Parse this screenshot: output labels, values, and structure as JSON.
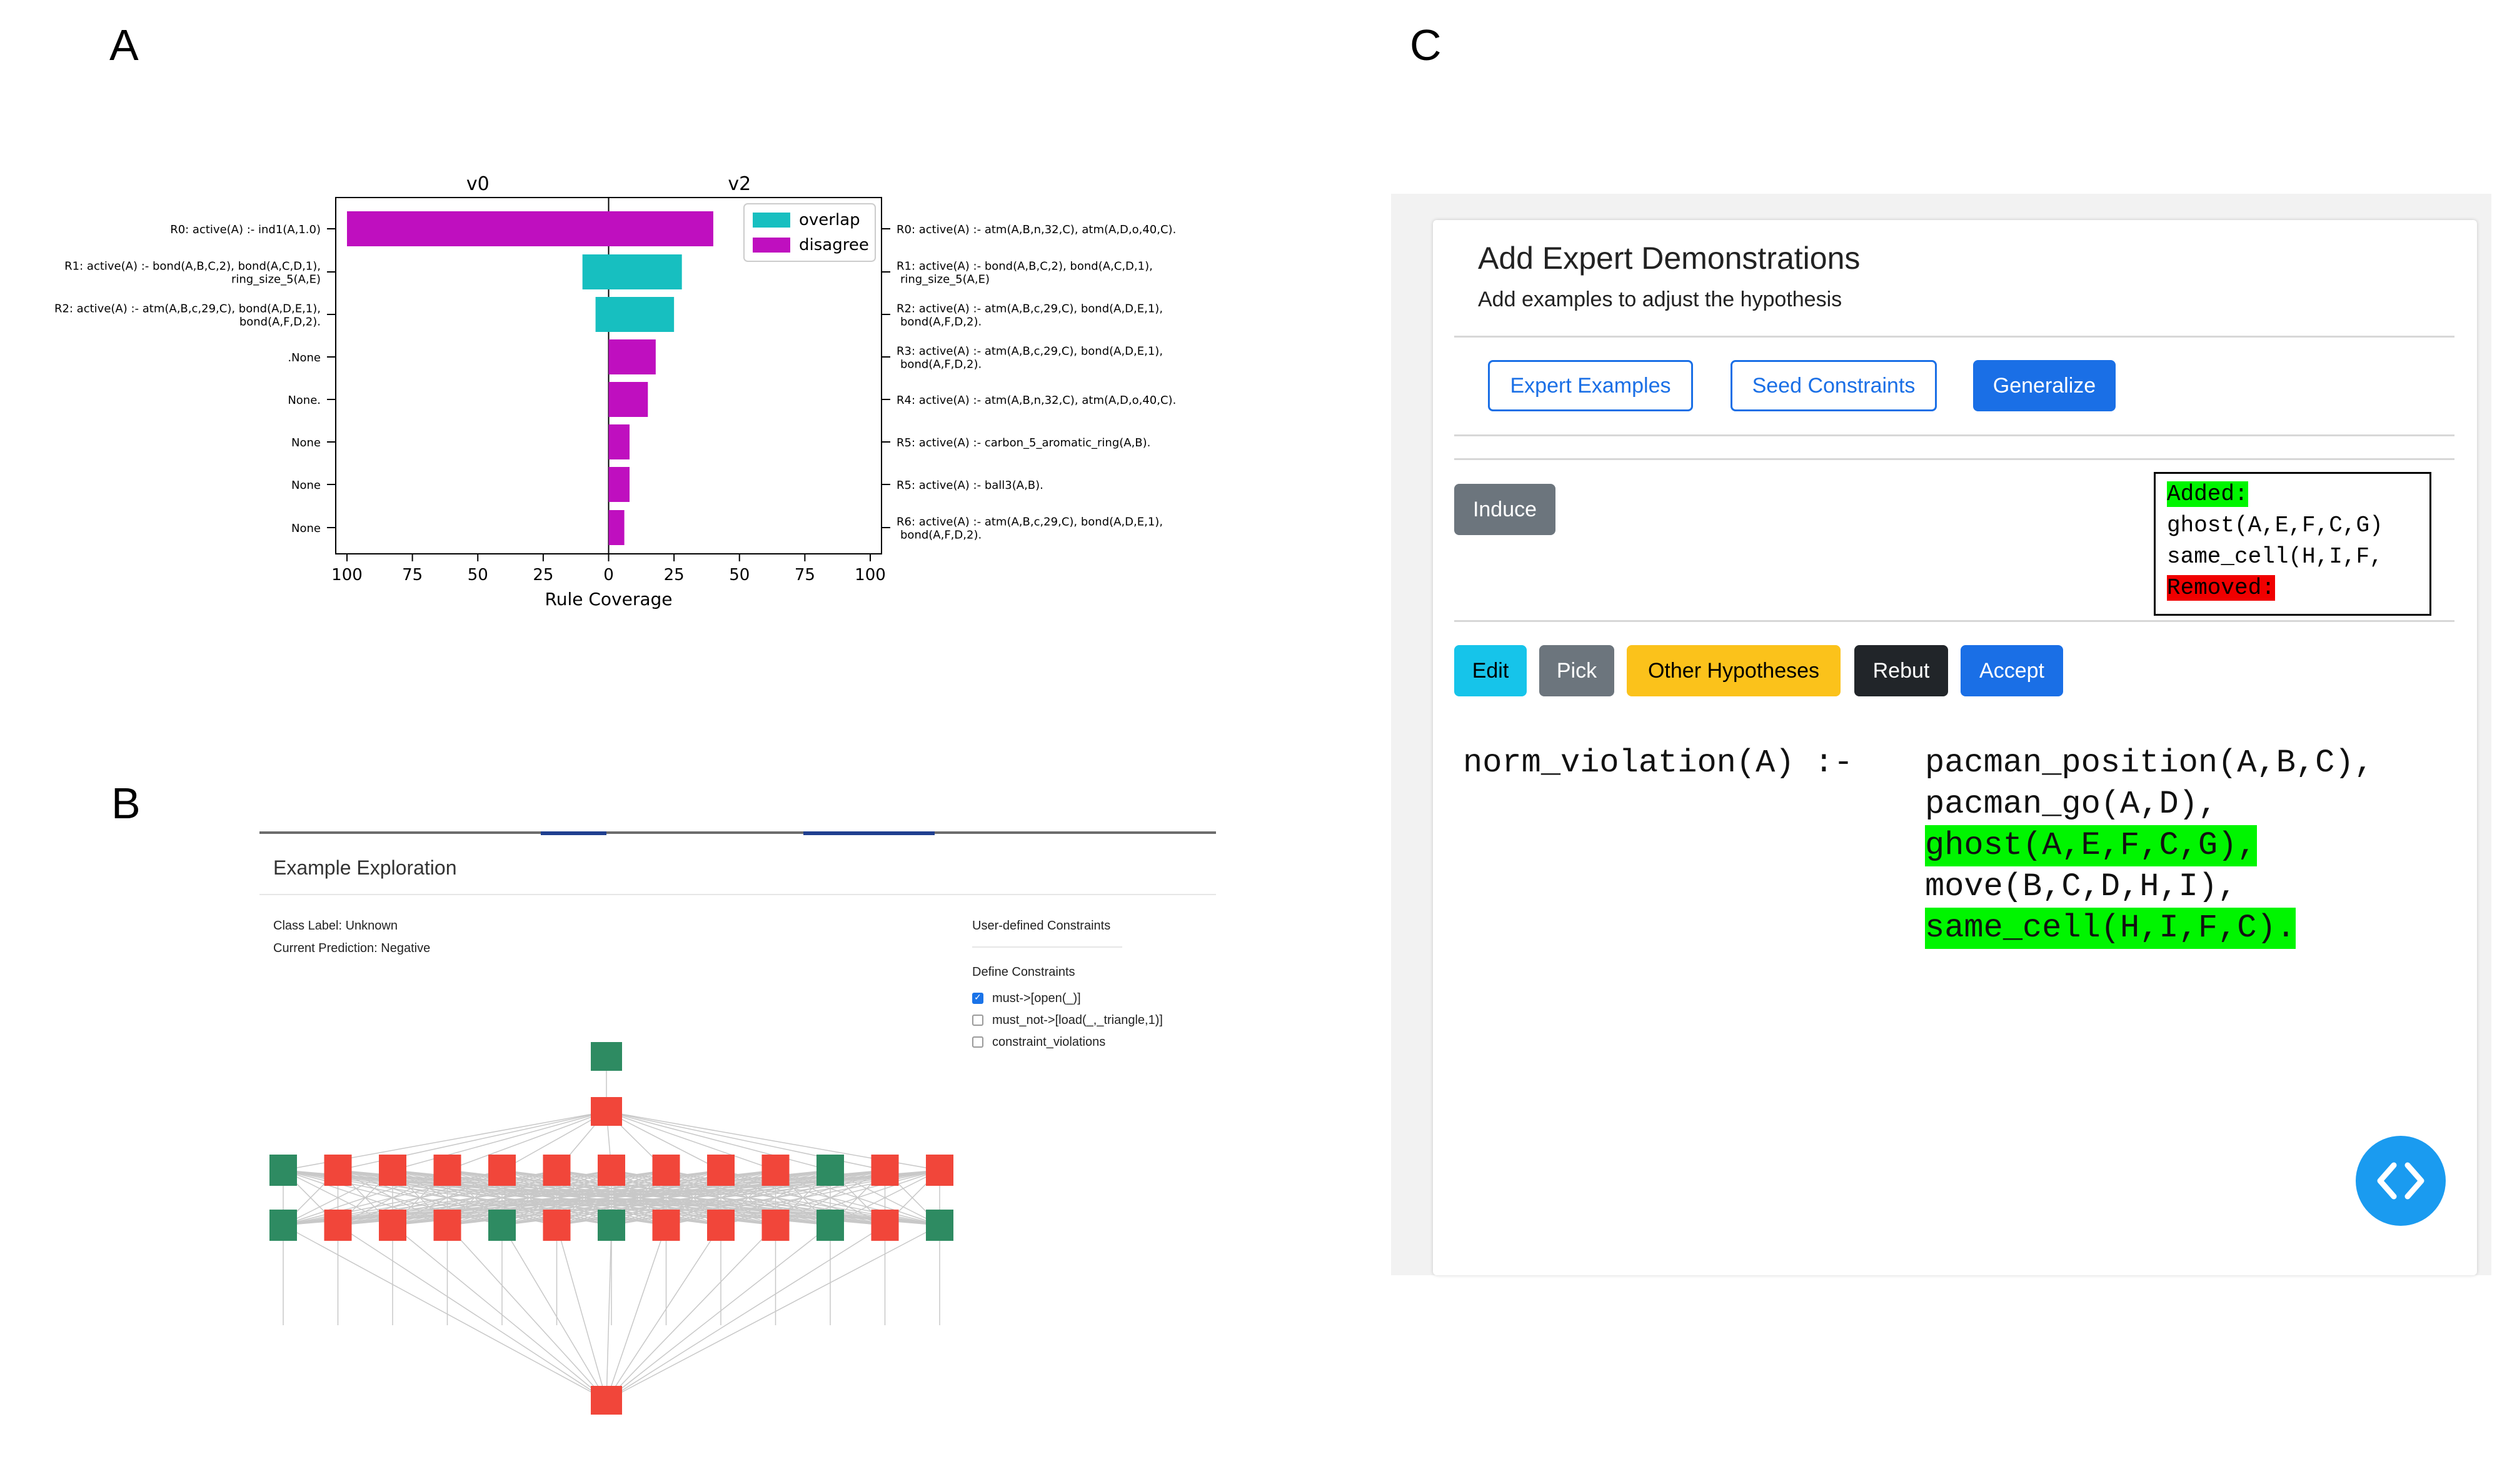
{
  "panel_labels": {
    "a": "A",
    "b": "B",
    "c": "C"
  },
  "chart_data": {
    "type": "bar",
    "orientation": "horizontal",
    "title_left": "v0",
    "title_right": "v2",
    "xlabel": "Rule Coverage",
    "xlim": [
      -100,
      100
    ],
    "x_tick_labels": [
      "100",
      "75",
      "50",
      "25",
      "0",
      "25",
      "50",
      "75",
      "100"
    ],
    "x_ticks": [
      -100,
      -75,
      -50,
      -25,
      0,
      25,
      50,
      75,
      100
    ],
    "legend": {
      "placement": "top-right",
      "entries": [
        {
          "name": "overlap",
          "color": "#17bfc0"
        },
        {
          "name": "disagree",
          "color": "#bf0fbf"
        }
      ]
    },
    "rows": [
      {
        "left": [
          "R0: active(A) :- ind1(A,1.0)"
        ],
        "right": [
          "R0: active(A) :- atm(A,B,n,32,C), atm(A,D,o,40,C)."
        ],
        "start": -100,
        "end": 40,
        "series": "disagree"
      },
      {
        "left": [
          "R1: active(A) :- bond(A,B,C,2), bond(A,C,D,1),",
          "ring_size_5(A,E)"
        ],
        "right": [
          "R1: active(A) :- bond(A,B,C,2), bond(A,C,D,1),",
          "ring_size_5(A,E)"
        ],
        "start": -10,
        "end": 28,
        "series": "overlap"
      },
      {
        "left": [
          "R2: active(A) :- atm(A,B,c,29,C), bond(A,D,E,1),",
          "bond(A,F,D,2)."
        ],
        "right": [
          "R2: active(A) :- atm(A,B,c,29,C), bond(A,D,E,1),",
          "bond(A,F,D,2)."
        ],
        "start": -5,
        "end": 25,
        "series": "overlap"
      },
      {
        "left": [
          ".None"
        ],
        "right": [
          "R3: active(A) :- atm(A,B,c,29,C), bond(A,D,E,1),",
          "bond(A,F,D,2)."
        ],
        "start": 0,
        "end": 18,
        "series": "disagree"
      },
      {
        "left": [
          "None."
        ],
        "right": [
          "R4: active(A) :- atm(A,B,n,32,C), atm(A,D,o,40,C)."
        ],
        "start": 0,
        "end": 15,
        "series": "disagree"
      },
      {
        "left": [
          "None"
        ],
        "right": [
          "R5: active(A) :- carbon_5_aromatic_ring(A,B)."
        ],
        "start": 0,
        "end": 8,
        "series": "disagree"
      },
      {
        "left": [
          "None"
        ],
        "right": [
          "R5: active(A) :- ball3(A,B)."
        ],
        "start": 0,
        "end": 8,
        "series": "disagree"
      },
      {
        "left": [
          "None"
        ],
        "right": [
          "R6: active(A) :- atm(A,B,c,29,C), bond(A,D,E,1),",
          "bond(A,F,D,2)."
        ],
        "start": 0,
        "end": 6,
        "series": "disagree"
      }
    ]
  },
  "exploration": {
    "title": "Example Exploration",
    "class_label": "Class Label: Unknown",
    "current_prediction": "Current Prediction: Negative",
    "constraints_header": "User-defined Constraints",
    "define_header": "Define Constraints",
    "constraints": [
      {
        "label": "must->[open(_)]",
        "checked": true
      },
      {
        "label": "must_not->[load(_,_triangle,1)]",
        "checked": false
      },
      {
        "label": "constraint_violations",
        "checked": false
      }
    ],
    "graph": {
      "green": "#2e8b62",
      "red": "#f1463a",
      "row2": [
        "green",
        "red",
        "red",
        "red",
        "red",
        "red",
        "red",
        "red",
        "red",
        "red",
        "green",
        "red",
        "red"
      ],
      "row3": [
        "green",
        "red",
        "red",
        "red",
        "green",
        "red",
        "green",
        "red",
        "red",
        "red",
        "green",
        "red",
        "green"
      ]
    }
  },
  "expert": {
    "title": "Add Expert Demonstrations",
    "subtitle": "Add examples to adjust the hypothesis",
    "tabs": {
      "expert_examples": "Expert Examples",
      "seed_constraints": "Seed Constraints",
      "generalize": "Generalize"
    },
    "induce": "Induce",
    "diff": {
      "added_label": "Added:",
      "lines": [
        "ghost(A,E,F,C,G)",
        "same_cell(H,I,F,"
      ],
      "removed_label": "Removed:"
    },
    "actions": {
      "edit": "Edit",
      "pick": "Pick",
      "other": "Other Hypotheses",
      "rebut": "Rebut",
      "accept": "Accept"
    },
    "code": {
      "head": "norm_violation(A) :-",
      "lines": [
        "pacman_position(A,B,C),",
        "pacman_go(A,D),",
        "ghost(A,E,F,C,G),",
        "move(B,C,D,H,I),",
        "same_cell(H,I,F,C)."
      ],
      "highlighted": [
        2,
        4
      ]
    }
  }
}
